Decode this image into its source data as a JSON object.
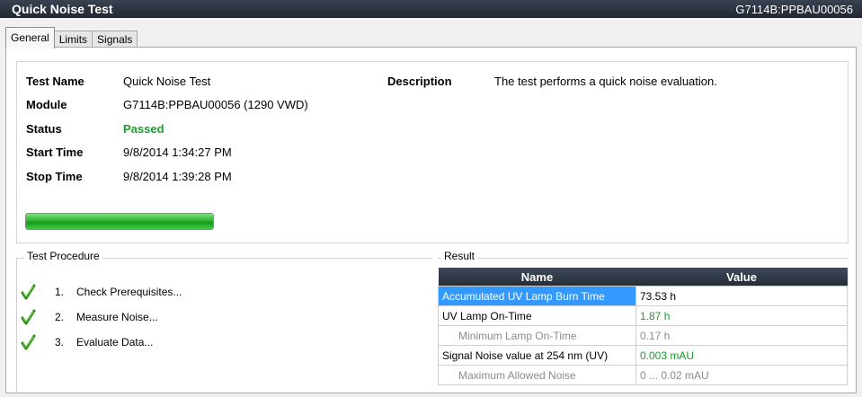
{
  "window": {
    "title": "Quick Noise Test",
    "identifier": "G7114B:PPBAU00056"
  },
  "tabs": [
    {
      "label": "General",
      "active": true
    },
    {
      "label": "Limits",
      "active": false
    },
    {
      "label": "Signals",
      "active": false
    }
  ],
  "general": {
    "fields": [
      {
        "label": "Test Name",
        "value": "Quick Noise Test"
      },
      {
        "label": "Module",
        "value": "G7114B:PPBAU00056 (1290 VWD)"
      },
      {
        "label": "Status",
        "value": "Passed"
      },
      {
        "label": "Start Time",
        "value": "9/8/2014 1:34:27 PM"
      },
      {
        "label": "Stop Time",
        "value": "9/8/2014 1:39:28 PM"
      }
    ],
    "description_label": "Description",
    "description_value": "The test performs a quick noise evaluation.",
    "progress_fraction": 1.0
  },
  "procedure": {
    "caption": "Test Procedure",
    "steps": [
      {
        "num": "1.",
        "label": "Check Prerequisites...",
        "icon": "check-icon"
      },
      {
        "num": "2.",
        "label": "Measure Noise...",
        "icon": "check-icon"
      },
      {
        "num": "3.",
        "label": "Evaluate Data...",
        "icon": "check-icon"
      }
    ]
  },
  "result": {
    "caption": "Result",
    "headers": {
      "name": "Name",
      "value": "Value"
    },
    "rows": [
      {
        "name": "Accumulated UV Lamp Burn Time",
        "value": "73.53 h"
      },
      {
        "name": "UV Lamp On-Time",
        "value": "1.87 h"
      },
      {
        "name": "Minimum Lamp On-Time",
        "value": "0.17 h"
      },
      {
        "name": "Signal Noise value at 254 nm (UV)",
        "value": "0.003 mAU"
      },
      {
        "name": "Maximum Allowed Noise",
        "value": "0 ... 0.02 mAU"
      }
    ]
  },
  "colors": {
    "passed": "#1f9a2f",
    "selection": "#3399ff",
    "header": "#2b3340"
  }
}
